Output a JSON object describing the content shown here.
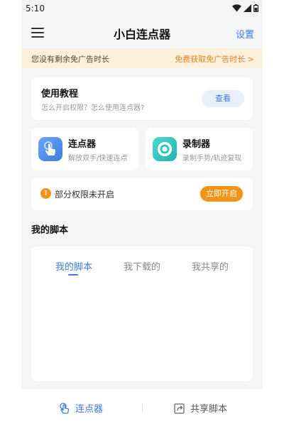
{
  "status_bar": {
    "time": "5:10",
    "icons": [
      "wifi-icon",
      "signal-icon",
      "battery-icon"
    ]
  },
  "header": {
    "menu_icon": "hamburger-menu-icon",
    "title": "小白连点器",
    "settings_label": "设置"
  },
  "ad_banner": {
    "message": "您没有剩余免广告时长",
    "action_label": "免费获取免广告时长 >"
  },
  "tutorial": {
    "title": "使用教程",
    "subtitle": "怎么开启权限？怎么使用连点器?",
    "button_label": "查看"
  },
  "features": [
    {
      "title": "连点器",
      "subtitle": "解放双手/快速连点",
      "icon": "tap-hand-icon",
      "color": "#4f8ff0"
    },
    {
      "title": "录制器",
      "subtitle": "录制手势/轨迹复现",
      "icon": "record-icon",
      "color": "#2fc5c0"
    }
  ],
  "permission": {
    "icon": "info-icon",
    "text": "部分权限未开启",
    "button_label": "立即开启"
  },
  "scripts": {
    "section_title": "我的脚本",
    "tabs": [
      {
        "label": "我的脚本",
        "active": true
      },
      {
        "label": "我下载的",
        "active": false
      },
      {
        "label": "我共享的",
        "active": false
      }
    ]
  },
  "bottom_nav": [
    {
      "label": "连点器",
      "icon": "tap-hand-icon",
      "active": true
    },
    {
      "label": "共享脚本",
      "icon": "share-icon",
      "active": false
    }
  ],
  "colors": {
    "accent": "#3f7be0",
    "orange": "#f29418",
    "banner_bg": "#fdf0dd"
  }
}
